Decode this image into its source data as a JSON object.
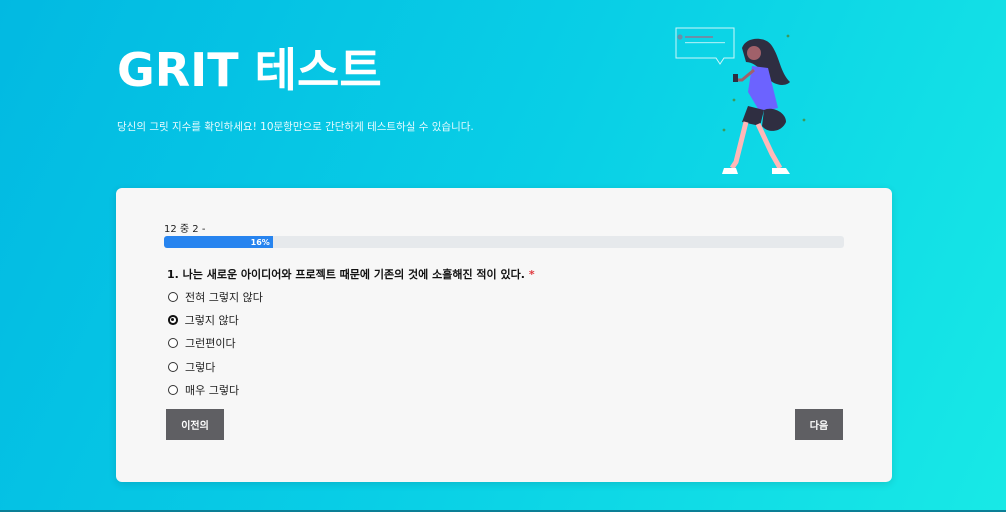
{
  "header": {
    "title": "GRIT 테스트",
    "subtitle": "당신의 그릿 지수를 확인하세요! 10문항만으로 간단하게 테스트하실 수 있습니다."
  },
  "illustration": {
    "icon": "woman-walking-with-phone-illustration"
  },
  "form": {
    "progress_label": "12 중 2 -",
    "progress_percent": 16,
    "progress_text": "16%",
    "question": "1. 나는 새로운 아이디어와 프로젝트 때문에 기존의 것에 소홀해진 적이 있다.",
    "required_mark": "*",
    "options": [
      {
        "label": "전혀 그렇지 않다",
        "selected": false
      },
      {
        "label": "그렇지 않다",
        "selected": true
      },
      {
        "label": "그런편이다",
        "selected": false
      },
      {
        "label": "그렇다",
        "selected": false
      },
      {
        "label": "매우 그렇다",
        "selected": false
      }
    ],
    "prev_label": "이전의",
    "next_label": "다음"
  },
  "colors": {
    "accent": "#2784ef",
    "button": "#5f5f63",
    "required": "#e0383e"
  }
}
